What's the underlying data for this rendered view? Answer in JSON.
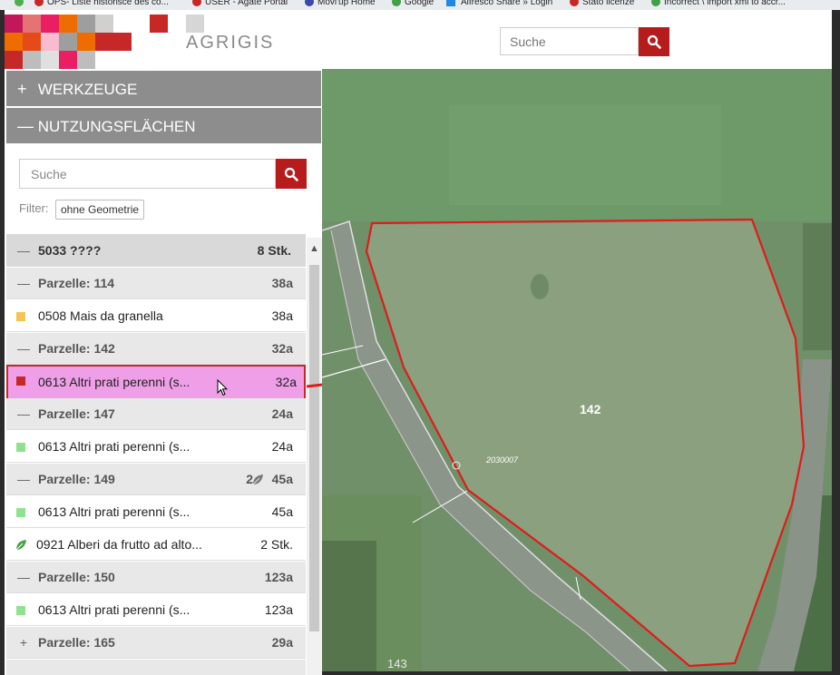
{
  "bookmarks": [
    {
      "label": "OPS- Liste historisce des co...",
      "color": "#c62828"
    },
    {
      "label": "USER - Agate Portal",
      "color": "#c62828"
    },
    {
      "label": "Movi'up Home",
      "color": "#3949ab"
    },
    {
      "label": "Google",
      "color": "#43a047"
    },
    {
      "label": "Alfresco Share » Login",
      "color": "#1e88e5"
    },
    {
      "label": "Stato licenze",
      "color": "#c62828"
    },
    {
      "label": "Incorrect \\ import xml to accr...",
      "color": "#43a047"
    }
  ],
  "header": {
    "logo_text": "AGRIGIS",
    "search": {
      "placeholder": "Suche"
    }
  },
  "panel": {
    "werkzeuge": {
      "symbol": "+",
      "label": "WERKZEUGE"
    },
    "nutzungsflaechen": {
      "symbol": "—",
      "label": "NUTZUNGSFLÄCHEN"
    },
    "search": {
      "placeholder": "Suche"
    },
    "filter_label": "Filter:",
    "filter_value": "ohne Geometrie",
    "rows": [
      {
        "kind": "top",
        "lead": "—",
        "label": "5033 ????",
        "value": "8 Stk."
      },
      {
        "kind": "group",
        "lead": "—",
        "label": "Parzelle: 114",
        "value": "38a"
      },
      {
        "kind": "item",
        "swatch": "#f6c453",
        "label": "0508 Mais da granella",
        "value": "38a"
      },
      {
        "kind": "group",
        "lead": "—",
        "label": "Parzelle: 142",
        "value": "32a"
      },
      {
        "kind": "selected",
        "swatch": "#c62828",
        "label": "0613 Altri prati perenni (s...",
        "value": "32a"
      },
      {
        "kind": "group",
        "lead": "—",
        "label": "Parzelle: 147",
        "value": "24a"
      },
      {
        "kind": "item",
        "swatch": "#8fe38f",
        "label": "0613 Altri prati perenni (s...",
        "value": "24a"
      },
      {
        "kind": "group",
        "lead": "—",
        "label": "Parzelle: 149",
        "extra": "2",
        "value": "45a"
      },
      {
        "kind": "item",
        "swatch": "#8fe38f",
        "label": "0613 Altri prati perenni (s...",
        "value": "45a"
      },
      {
        "kind": "leaf",
        "label": "0921 Alberi da frutto ad alto...",
        "value": "2 Stk."
      },
      {
        "kind": "group",
        "lead": "—",
        "label": "Parzelle: 150",
        "value": "123a"
      },
      {
        "kind": "item",
        "swatch": "#8fe38f",
        "label": "0613 Altri prati perenni (s...",
        "value": "123a"
      },
      {
        "kind": "group",
        "lead": "+",
        "label": "Parzelle: 165",
        "value": "29a"
      }
    ]
  },
  "map": {
    "parcel_label": "142",
    "parcel_code": "2030007",
    "neighbor_label": "143",
    "parcel_stroke": "#e01b1b",
    "arrow_color": "#e01b1b"
  }
}
